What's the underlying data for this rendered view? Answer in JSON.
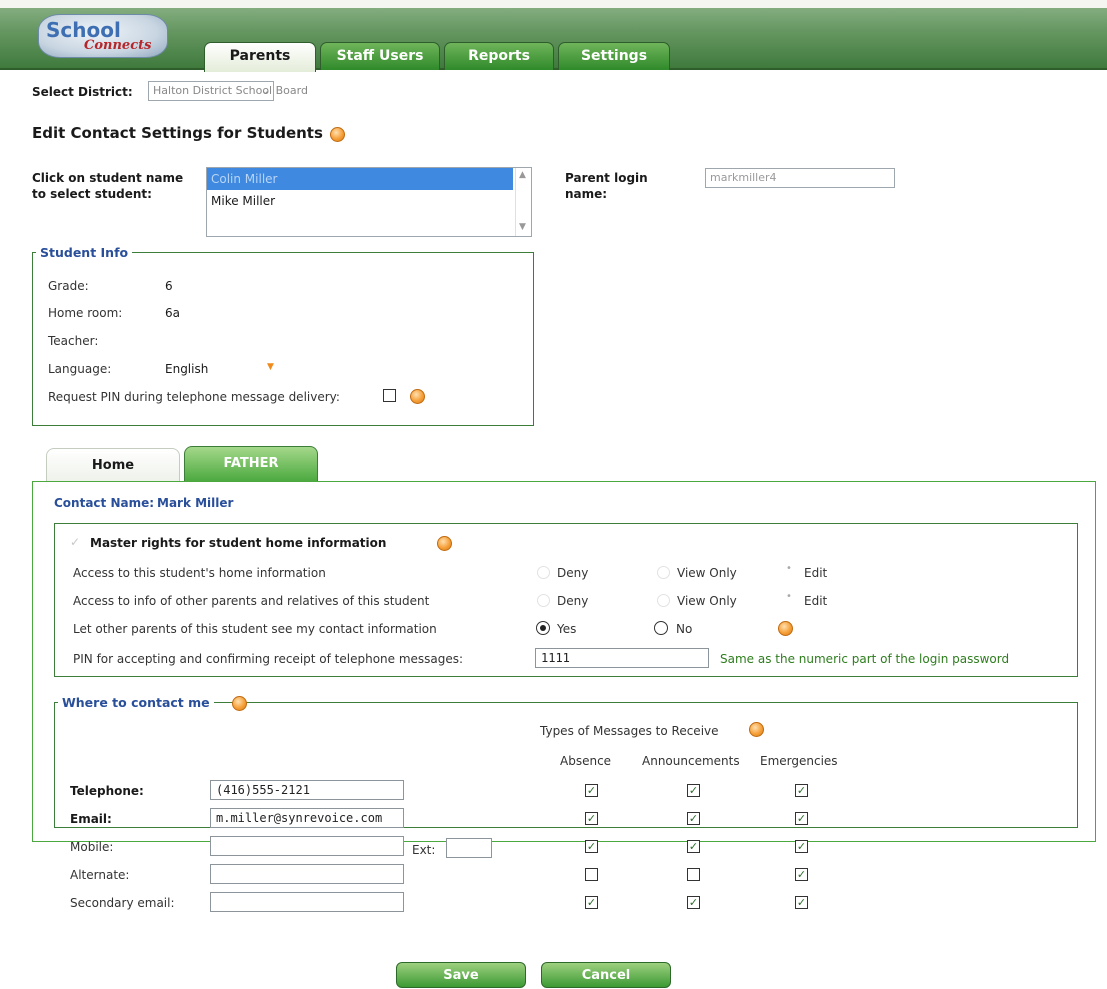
{
  "header": {
    "logo_line1": "School",
    "logo_line2": "Connects",
    "tabs": [
      {
        "label": "Parents",
        "active": true
      },
      {
        "label": "Staff Users",
        "active": false
      },
      {
        "label": "Reports",
        "active": false
      },
      {
        "label": "Settings",
        "active": false
      }
    ]
  },
  "district": {
    "label": "Select District:",
    "value": "Halton District School Board"
  },
  "page_title": "Edit Contact Settings for Students",
  "student_select": {
    "label_line1": "Click on student name",
    "label_line2": "to select student:",
    "items": [
      "Colin Miller",
      "Mike Miller"
    ],
    "selected": "Colin Miller"
  },
  "parent_login": {
    "label_line1": "Parent login",
    "label_line2": "name:",
    "value": "markmiller4"
  },
  "student_info": {
    "legend": "Student Info",
    "grade_label": "Grade:",
    "grade": "6",
    "homeroom_label": "Home room:",
    "homeroom": "6a",
    "teacher_label": "Teacher:",
    "teacher": "",
    "language_label": "Language:",
    "language": "English",
    "pin_request_label": "Request PIN during telephone message delivery:",
    "pin_request_checked": false
  },
  "contact_tabs": [
    {
      "label": "Home",
      "active": false
    },
    {
      "label": "FATHER",
      "active": true
    }
  ],
  "contact": {
    "name_label": "Contact Name:",
    "name": "Mark Miller",
    "master_rights_label": "Master rights for student home information",
    "rows": [
      {
        "label": "Access to this student's home information",
        "options": [
          "Deny",
          "View Only",
          "Edit"
        ],
        "selected": "Edit"
      },
      {
        "label": "Access to info of other parents and relatives of this student",
        "options": [
          "Deny",
          "View Only",
          "Edit"
        ],
        "selected": "Edit"
      }
    ],
    "share_label": "Let other parents of this student see my contact information",
    "share_yes": "Yes",
    "share_no": "No",
    "share_selected": "Yes",
    "pin_label": "PIN for accepting and confirming receipt of telephone messages:",
    "pin_value": "1111",
    "pin_note": "Same as the numeric part of the login password"
  },
  "where_to_contact": {
    "legend": "Where to contact me",
    "types_heading": "Types of Messages to Receive",
    "columns": [
      "Absence",
      "Announcements",
      "Emergencies"
    ],
    "rows": [
      {
        "label": "Telephone:",
        "bold": true,
        "value": "(416)555-2121",
        "checks": [
          true,
          true,
          true
        ]
      },
      {
        "label": "Email:",
        "bold": true,
        "value": "m.miller@synrevoice.com",
        "checks": [
          true,
          true,
          true
        ]
      },
      {
        "label": "Mobile:",
        "bold": false,
        "value": "",
        "checks": [
          true,
          true,
          true
        ]
      },
      {
        "label": "Alternate:",
        "bold": false,
        "value": "",
        "checks": [
          false,
          false,
          true
        ]
      },
      {
        "label": "Secondary email:",
        "bold": false,
        "value": "",
        "checks": [
          true,
          true,
          true
        ]
      }
    ],
    "ext_label": "Ext:",
    "ext_value": ""
  },
  "buttons": {
    "save": "Save",
    "cancel": "Cancel"
  },
  "colors": {
    "brand_green": "#3c9a34",
    "link_blue": "#2a4f9a",
    "help_orange": "#f6a03a",
    "selection_blue": "#3f8ae0"
  }
}
